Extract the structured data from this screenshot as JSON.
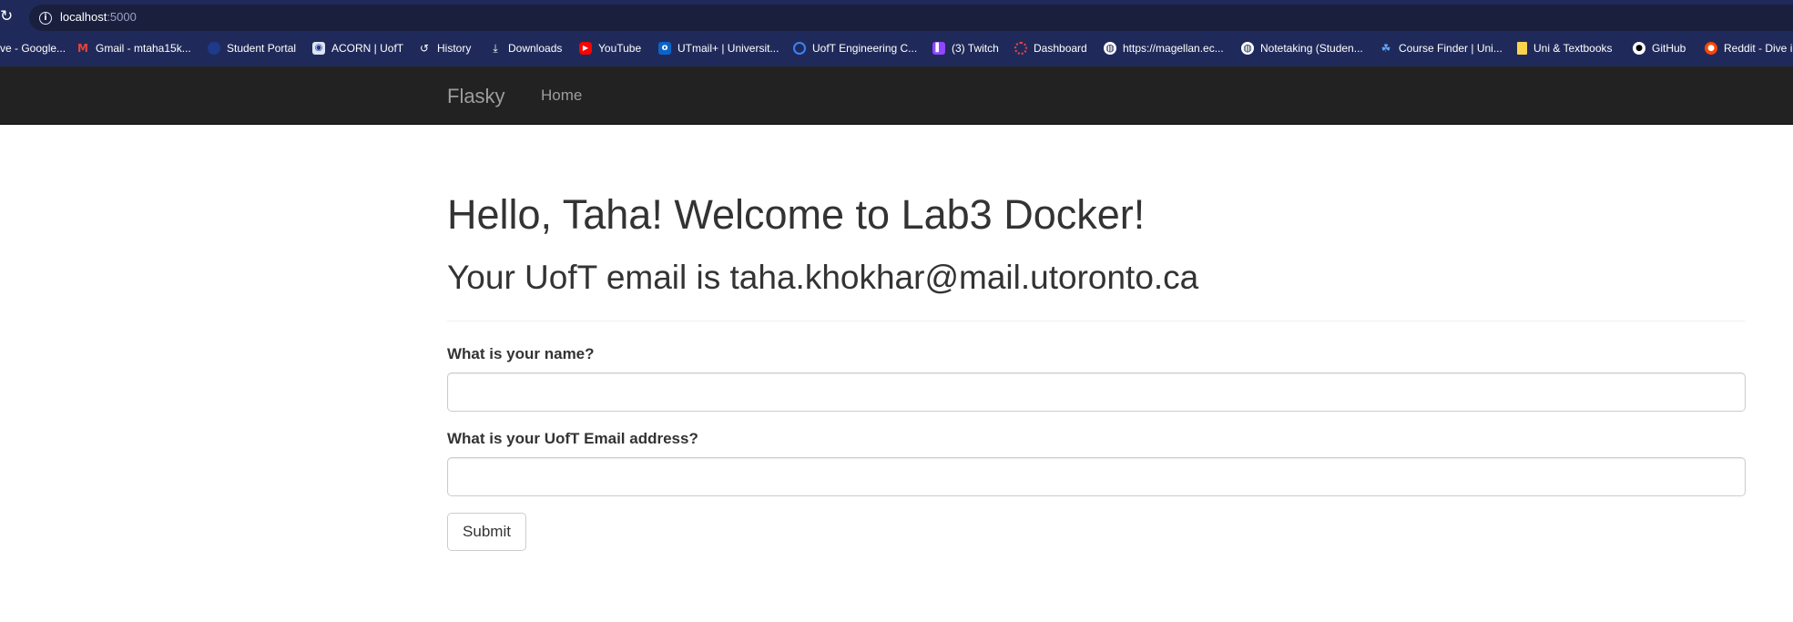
{
  "browser": {
    "url_host": "localhost",
    "url_port": ":5000",
    "bookmarks": [
      {
        "label": "ve - Google...",
        "icon": ""
      },
      {
        "label": "Gmail - mtaha15k...",
        "icon": "gmail-icon"
      },
      {
        "label": "Student Portal",
        "icon": "student-portal-icon"
      },
      {
        "label": "ACORN | UofT",
        "icon": "acorn-icon"
      },
      {
        "label": "History",
        "icon": "history-icon"
      },
      {
        "label": "Downloads",
        "icon": "download-icon"
      },
      {
        "label": "YouTube",
        "icon": "youtube-icon"
      },
      {
        "label": "UTmail+ | Universit...",
        "icon": "outlook-icon"
      },
      {
        "label": "UofT Engineering C...",
        "icon": "engineering-icon"
      },
      {
        "label": "(3) Twitch",
        "icon": "twitch-icon"
      },
      {
        "label": "Dashboard",
        "icon": "dashboard-icon"
      },
      {
        "label": "https://magellan.ec...",
        "icon": "globe-icon"
      },
      {
        "label": "Notetaking (Studen...",
        "icon": "globe-icon"
      },
      {
        "label": "Course Finder | Uni...",
        "icon": "course-finder-icon"
      },
      {
        "label": "Uni & Textbooks",
        "icon": "folder-icon"
      },
      {
        "label": "GitHub",
        "icon": "github-icon"
      },
      {
        "label": "Reddit - Dive i",
        "icon": "reddit-icon"
      }
    ]
  },
  "navbar": {
    "brand": "Flasky",
    "home": "Home"
  },
  "main": {
    "greeting": "Hello, Taha! Welcome to Lab3 Docker!",
    "email_line": "Your UofT email is taha.khokhar@mail.utoronto.ca",
    "name_label": "What is your name?",
    "name_value": "",
    "email_label": "What is your UofT Email address?",
    "email_value": "",
    "submit_label": "Submit"
  },
  "colors": {
    "browser_frame": "#202a5a",
    "navbar_bg": "#222222",
    "navbar_text": "#9d9d9d",
    "heading_text": "#333333"
  }
}
